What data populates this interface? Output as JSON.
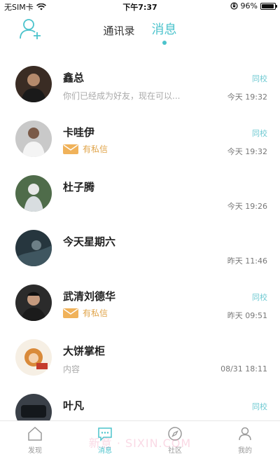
{
  "status_bar": {
    "carrier": "无SIM卡",
    "time": "下午7:37",
    "battery_text": "96%",
    "battery_level": 0.96
  },
  "header": {
    "add_friend_icon": "add-user-icon",
    "tabs": [
      {
        "label": "通讯录",
        "active": false
      },
      {
        "label": "消息",
        "active": true
      }
    ]
  },
  "accent_color": "#4cc3cc",
  "conversations": [
    {
      "name": "鑫总",
      "preview": "你们已经成为好友，现在可以...",
      "tag": "同校",
      "time": "今天 19:32"
    },
    {
      "name": "卡哇伊",
      "private_label": "有私信",
      "tag": "同校",
      "time": "今天 19:32"
    },
    {
      "name": "杜子腾",
      "time": "今天 19:26"
    },
    {
      "name": "今天星期六",
      "time": "昨天 11:46"
    },
    {
      "name": "武清刘德华",
      "private_label": "有私信",
      "tag": "同校",
      "time": "昨天 09:51"
    },
    {
      "name": "大饼掌柜",
      "preview": "内容",
      "time": "08/31 18:11"
    },
    {
      "name": "叶凡",
      "tag": "同校"
    }
  ],
  "tab_bar": [
    {
      "label": "发现",
      "icon": "home-icon",
      "active": false
    },
    {
      "label": "消息",
      "icon": "message-icon",
      "active": true
    },
    {
      "label": "社区",
      "icon": "compass-icon",
      "active": false
    },
    {
      "label": "我的",
      "icon": "profile-icon",
      "active": false
    }
  ],
  "watermark": "新意 · SIXIN.COM"
}
